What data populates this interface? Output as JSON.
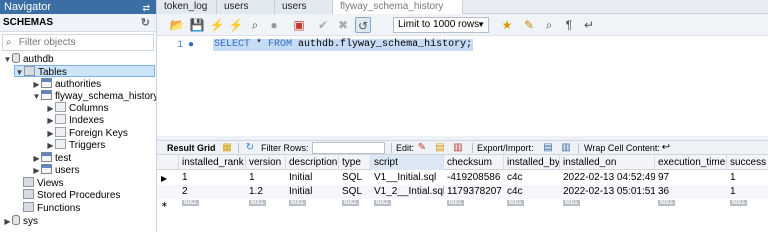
{
  "navigator": {
    "title": "Navigator",
    "schemas_label": "SCHEMAS",
    "filter_placeholder": "Filter objects",
    "tree": [
      {
        "label": "authdb"
      },
      {
        "label": "Tables"
      },
      {
        "label": "authorities"
      },
      {
        "label": "flyway_schema_history"
      },
      {
        "label": "Columns"
      },
      {
        "label": "Indexes"
      },
      {
        "label": "Foreign Keys"
      },
      {
        "label": "Triggers"
      },
      {
        "label": "test"
      },
      {
        "label": "users"
      },
      {
        "label": "Views"
      },
      {
        "label": "Stored Procedures"
      },
      {
        "label": "Functions"
      },
      {
        "label": "sys"
      }
    ]
  },
  "tabs": [
    {
      "label": "token_log"
    },
    {
      "label": "users"
    },
    {
      "label": "users"
    },
    {
      "label": "flyway_schema_history"
    }
  ],
  "editor_toolbar": {
    "limit_value": "Limit to 1000 rows"
  },
  "editor": {
    "line_number": "1",
    "sql": {
      "kw1": "SELECT",
      "star": " * ",
      "kw2": "FROM",
      "rest": " authdb.flyway_schema_history;"
    }
  },
  "result_toolbar": {
    "result_grid": "Result Grid",
    "filter_rows": "Filter Rows:",
    "edit": "Edit:",
    "export_import": "Export/Import:",
    "wrap": "Wrap Cell Content:"
  },
  "grid": {
    "columns": [
      "installed_rank",
      "version",
      "description",
      "type",
      "script",
      "checksum",
      "installed_by",
      "installed_on",
      "execution_time",
      "success"
    ],
    "rows": [
      [
        "1",
        "1",
        "Initial",
        "SQL",
        "V1__Initial.sql",
        "-419208586",
        "c4c",
        "2022-02-13 04:52:49",
        "97",
        "1"
      ],
      [
        "2",
        "1.2",
        "Initial",
        "SQL",
        "V1_2__Intial.sql",
        "1179378207",
        "c4c",
        "2022-02-13 05:01:51",
        "36",
        "1"
      ]
    ],
    "null_label": "NULL"
  }
}
